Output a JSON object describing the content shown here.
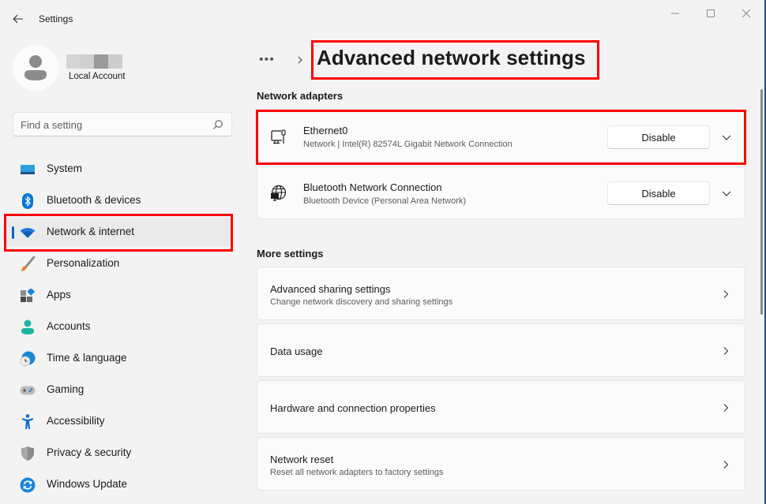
{
  "window": {
    "app_title": "Settings",
    "controls": {
      "minimize": "minimize-icon",
      "maximize": "maximize-icon",
      "close": "close-icon"
    }
  },
  "profile": {
    "account_type": "Local Account",
    "name_redacted_colors": [
      "#d4d4d4",
      "#cfcfcf",
      "#9a9a9a",
      "#cdcdcd"
    ]
  },
  "search": {
    "placeholder": "Find a setting",
    "value": ""
  },
  "sidebar": {
    "items": [
      {
        "label": "System",
        "icon": "system-icon",
        "active": false
      },
      {
        "label": "Bluetooth & devices",
        "icon": "bluetooth-icon",
        "active": false
      },
      {
        "label": "Network & internet",
        "icon": "wifi-icon",
        "active": true
      },
      {
        "label": "Personalization",
        "icon": "brush-icon",
        "active": false
      },
      {
        "label": "Apps",
        "icon": "apps-icon",
        "active": false
      },
      {
        "label": "Accounts",
        "icon": "accounts-icon",
        "active": false
      },
      {
        "label": "Time & language",
        "icon": "time-language-icon",
        "active": false
      },
      {
        "label": "Gaming",
        "icon": "gamepad-icon",
        "active": false
      },
      {
        "label": "Accessibility",
        "icon": "accessibility-icon",
        "active": false
      },
      {
        "label": "Privacy & security",
        "icon": "shield-icon",
        "active": false
      },
      {
        "label": "Windows Update",
        "icon": "update-icon",
        "active": false
      }
    ]
  },
  "breadcrumb": {
    "more": "•••",
    "title": "Advanced network settings"
  },
  "network_adapters": {
    "heading": "Network adapters",
    "items": [
      {
        "name": "Ethernet0",
        "detail": "Network | Intel(R) 82574L Gigabit Network Connection",
        "button": "Disable",
        "icon": "ethernet-icon"
      },
      {
        "name": "Bluetooth Network Connection",
        "detail": "Bluetooth Device (Personal Area Network)",
        "button": "Disable",
        "icon": "globe-network-icon"
      }
    ]
  },
  "more_settings": {
    "heading": "More settings",
    "items": [
      {
        "title": "Advanced sharing settings",
        "subtitle": "Change network discovery and sharing settings"
      },
      {
        "title": "Data usage",
        "subtitle": ""
      },
      {
        "title": "Hardware and connection properties",
        "subtitle": ""
      },
      {
        "title": "Network reset",
        "subtitle": "Reset all network adapters to factory settings"
      }
    ]
  },
  "colors": {
    "accent": "#0067c0",
    "highlight": "#ff0000",
    "background": "#f3f3f3",
    "card": "#fbfbfb"
  }
}
